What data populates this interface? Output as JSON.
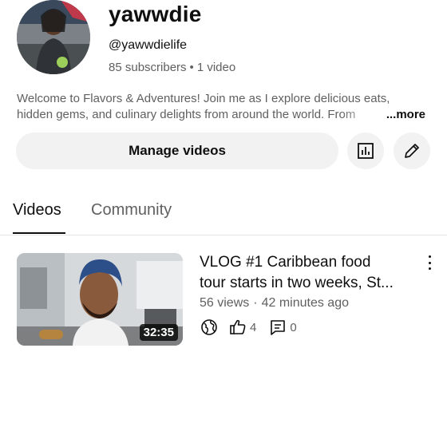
{
  "channel": {
    "name": "yawwdie",
    "handle": "@yawwdielife",
    "subscribers": "85 subscribers",
    "separator": "•",
    "video_count": "1 video",
    "description_line1": "Welcome to Flavors & Adventures! Join me as I explore delicious eats,",
    "description_line2": "hidden gems, and culinary delights from around the world. From",
    "more_label": "...more"
  },
  "actions": {
    "manage_videos_label": "Manage videos",
    "analytics_icon": "analytics-icon",
    "edit_icon": "pencil-icon"
  },
  "tabs": [
    {
      "label": "Videos",
      "selected": true
    },
    {
      "label": "Community",
      "selected": false
    }
  ],
  "videos": [
    {
      "title_line1": "VLOG #1 Caribbean food",
      "title_line2": "tour starts in two weeks, St...",
      "duration": "32:35",
      "views": "56 views",
      "separator": "·",
      "age": "42 minutes ago",
      "likes": "4",
      "comments": "0",
      "visibility_icon": "globe-icon"
    }
  ],
  "colors": {
    "text_primary": "#0f0f0f",
    "text_secondary": "#606060",
    "button_bg": "#f2f2f2",
    "divider": "#e5e5e5"
  }
}
